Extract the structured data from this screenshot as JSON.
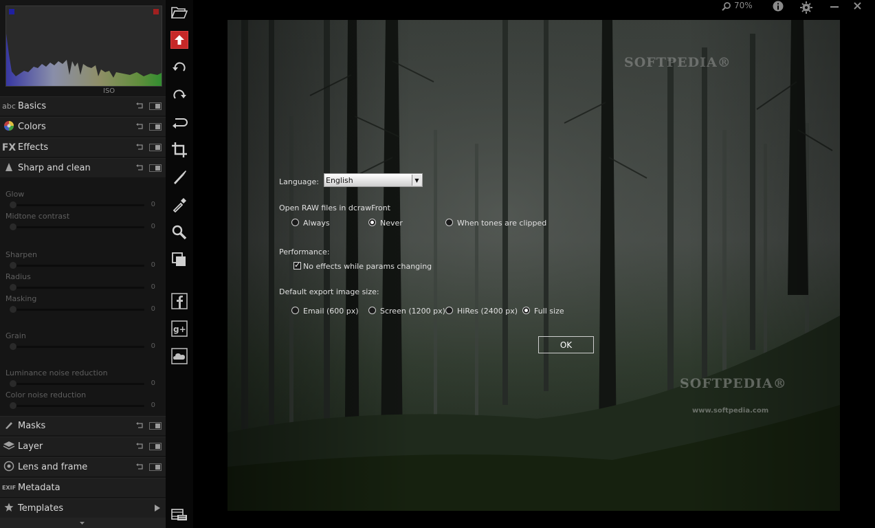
{
  "histogram": {
    "label": "ISO"
  },
  "panel": {
    "sections_top": [
      {
        "icon": "abc",
        "label": "Basics"
      },
      {
        "icon": "",
        "label": "Colors"
      },
      {
        "icon": "FX",
        "label": "Effects"
      },
      {
        "icon": "",
        "label": "Sharp and clean"
      }
    ],
    "sliders": [
      {
        "label": "Glow",
        "value": "0"
      },
      {
        "label": "Midtone contrast",
        "value": "0"
      },
      {
        "label": "Sharpen",
        "value": "0"
      },
      {
        "label": "Radius",
        "value": "0"
      },
      {
        "label": "Masking",
        "value": "0"
      },
      {
        "label": "Grain",
        "value": "0"
      },
      {
        "label": "Luminance noise reduction",
        "value": "0"
      },
      {
        "label": "Color noise reduction",
        "value": "0"
      }
    ],
    "sections_bottom": [
      {
        "icon": "",
        "label": "Masks"
      },
      {
        "icon": "",
        "label": "Layer"
      },
      {
        "icon": "",
        "label": "Lens and frame"
      },
      {
        "icon": "EXIF",
        "label": "Metadata"
      },
      {
        "icon": "",
        "label": "Templates"
      }
    ]
  },
  "topbar": {
    "zoom": "70%"
  },
  "watermark": {
    "top": "SOFTPEDIA®",
    "middle": "SOFTPEDIA®",
    "url": "www.softpedia.com"
  },
  "dialog": {
    "language_label": "Language:",
    "language_value": "English",
    "raw_label": "Open RAW files in dcrawFront",
    "raw_options": [
      "Always",
      "Never",
      "When tones are clipped"
    ],
    "raw_selected": "Never",
    "performance_label": "Performance:",
    "performance_checkbox": "No effects while params changing",
    "performance_checked": true,
    "export_label": "Default export image size:",
    "export_options": [
      "Email (600 px)",
      "Screen (1200 px)",
      "HiRes (2400 px)",
      "Full size"
    ],
    "export_selected": "Full size",
    "ok_label": "OK"
  },
  "colors": {
    "accent_red": "#c62828",
    "panel_bg": "#151515",
    "toolbar_bg": "#080808"
  }
}
